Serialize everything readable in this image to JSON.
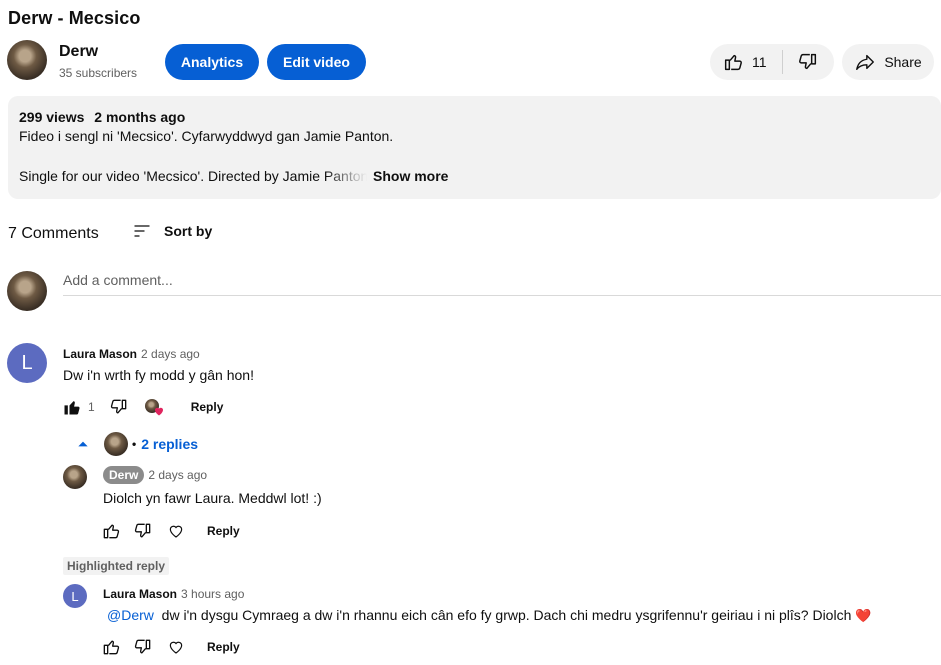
{
  "video": {
    "title": "Derw - Mecsico"
  },
  "channel": {
    "name": "Derw",
    "subscribers": "35 subscribers",
    "analytics_label": "Analytics",
    "edit_label": "Edit video"
  },
  "actions": {
    "like_count": "11",
    "share_label": "Share"
  },
  "description": {
    "views": "299 views",
    "age": "2 months ago",
    "line1": "Fideo i sengl ni 'Mecsico'. Cyfarwyddwyd gan Jamie Panton.",
    "line2": "Single for our video 'Mecsico'. Directed by Jamie Panton.",
    "show_more": "Show more"
  },
  "comments_header": {
    "count": "7 Comments",
    "sort_label": "Sort by",
    "add_placeholder": "Add a comment..."
  },
  "comment1": {
    "avatar_letter": "L",
    "author": "Laura Mason",
    "time": "2 days ago",
    "text": "Dw i'n wrth fy modd y gân hon!",
    "likes": "1",
    "reply_label": "Reply",
    "replies_label": "2 replies",
    "replies_separator": "•"
  },
  "reply1": {
    "author": "Derw",
    "time": "2 days ago",
    "text": "Diolch yn fawr Laura. Meddwl lot! :)",
    "reply_label": "Reply"
  },
  "reply2": {
    "highlight_label": "Highlighted reply",
    "avatar_letter": "L",
    "author": "Laura Mason",
    "time": "3 hours ago",
    "mention": "@Derw",
    "text": "dw i'n dysgu Cymraeg a dw i'n rhannu eich cân efo fy grwp.  Dach chi medru  ysgrifennu'r geiriau i ni plîs? Diolch",
    "emoji": "❤️",
    "reply_label": "Reply"
  },
  "colors": {
    "accent": "#065fd4",
    "letter_avatar": "#5c6bc0",
    "heart": "#e0245e"
  }
}
